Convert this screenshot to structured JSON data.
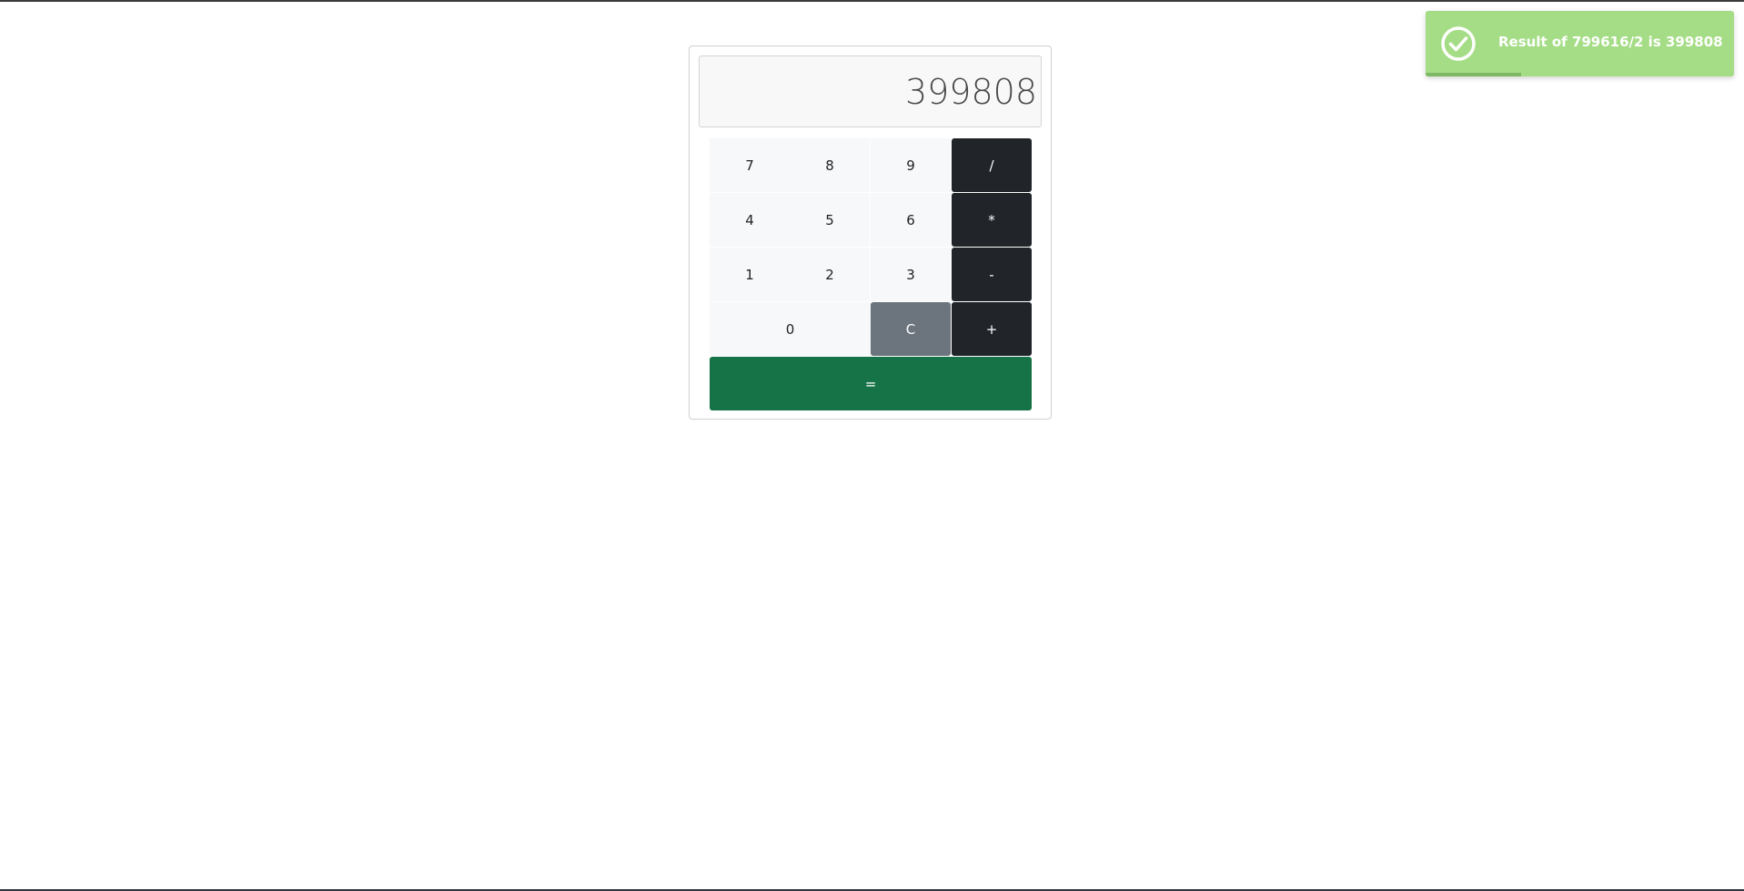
{
  "calculator": {
    "display": "399808",
    "keys": {
      "k7": "7",
      "k8": "8",
      "k9": "9",
      "div": "/",
      "k4": "4",
      "k5": "5",
      "k6": "6",
      "mul": "*",
      "k1": "1",
      "k2": "2",
      "k3": "3",
      "sub": "-",
      "k0": "0",
      "clear": "C",
      "add": "+",
      "equals": "="
    }
  },
  "toast": {
    "message": "Result of 799616/2 is 399808",
    "icon": "check-circle-icon",
    "progress": 0.31,
    "color": "#a5dd86"
  },
  "colors": {
    "operator": "#212529",
    "clear": "#6c757d",
    "equals": "#167347",
    "digit": "#f7f8fa"
  }
}
